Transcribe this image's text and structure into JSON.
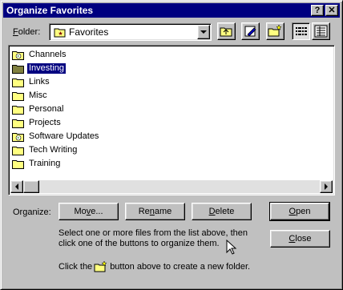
{
  "window": {
    "title": "Organize Favorites"
  },
  "toolbar": {
    "folder_label_prefix": "F",
    "folder_label_rest": "older:",
    "folder_value": "Favorites"
  },
  "folders": [
    {
      "name": "Channels",
      "type": "channel"
    },
    {
      "name": "Investing",
      "type": "folder",
      "selected": true
    },
    {
      "name": "Links",
      "type": "folder"
    },
    {
      "name": "Misc",
      "type": "folder"
    },
    {
      "name": "Personal",
      "type": "folder"
    },
    {
      "name": "Projects",
      "type": "folder"
    },
    {
      "name": "Software Updates",
      "type": "channel"
    },
    {
      "name": "Tech Writing",
      "type": "folder"
    },
    {
      "name": "Training",
      "type": "folder"
    }
  ],
  "actions": {
    "organize_label": "Organize:",
    "move_pre": "Mo",
    "move_u": "v",
    "move_post": "e...",
    "rename_pre": "Re",
    "rename_u": "n",
    "rename_post": "ame",
    "delete_pre": "",
    "delete_u": "D",
    "delete_post": "elete",
    "open_pre": "",
    "open_u": "O",
    "open_post": "pen",
    "close_pre": "",
    "close_u": "C",
    "close_post": "lose"
  },
  "hints": {
    "select_line1": "Select one or more files from the list above, then",
    "select_line2": "click one of the buttons to organize them.",
    "create_pre": "Click the",
    "create_post": "button above to create a new folder."
  },
  "colors": {
    "titlebar": "#000080",
    "folder": "#ffff80",
    "selection": "#000080"
  }
}
